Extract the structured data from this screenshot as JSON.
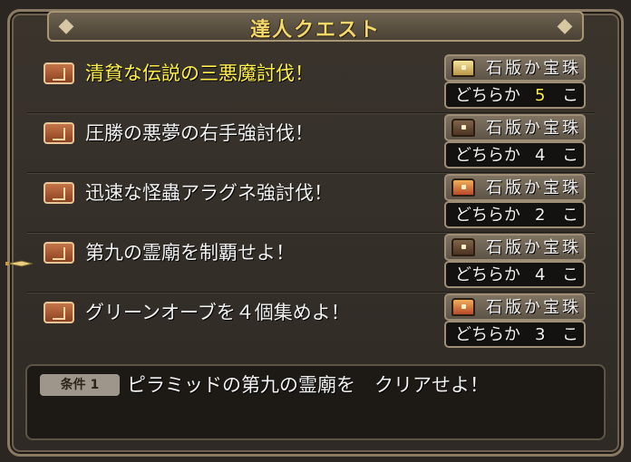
{
  "window": {
    "title": "達人クエスト"
  },
  "quests": [
    {
      "title": "清貧な伝説の三悪魔討伐！",
      "reward_name": "石版か宝珠",
      "reward_prefix": "どちらか",
      "reward_count": "5",
      "reward_unit": "こ",
      "chest": "gold-chest-icon",
      "selected": true
    },
    {
      "title": "圧勝の悪夢の右手強討伐！",
      "reward_name": "石版か宝珠",
      "reward_prefix": "どちらか",
      "reward_count": "4",
      "reward_unit": "こ",
      "chest": "dark-chest-icon",
      "selected": false
    },
    {
      "title": "迅速な怪蟲アラグネ強討伐！",
      "reward_name": "石版か宝珠",
      "reward_prefix": "どちらか",
      "reward_count": "2",
      "reward_unit": "こ",
      "chest": "red-chest-icon",
      "selected": false
    },
    {
      "title": "第九の霊廟を制覇せよ！",
      "reward_name": "石版か宝珠",
      "reward_prefix": "どちらか",
      "reward_count": "4",
      "reward_unit": "こ",
      "chest": "dark-chest-icon",
      "selected": false
    },
    {
      "title": "グリーンオーブを４個集めよ！",
      "reward_name": "石版か宝珠",
      "reward_prefix": "どちらか",
      "reward_count": "3",
      "reward_unit": "こ",
      "chest": "red-chest-icon",
      "selected": false
    }
  ],
  "condition": {
    "label": "条件 1",
    "text": "ピラミッドの第九の霊廟を　クリアせよ！"
  },
  "colors": {
    "selected_text": "#fff04a",
    "normal_text": "#f2f2f2",
    "title_text": "#f4d96a"
  }
}
